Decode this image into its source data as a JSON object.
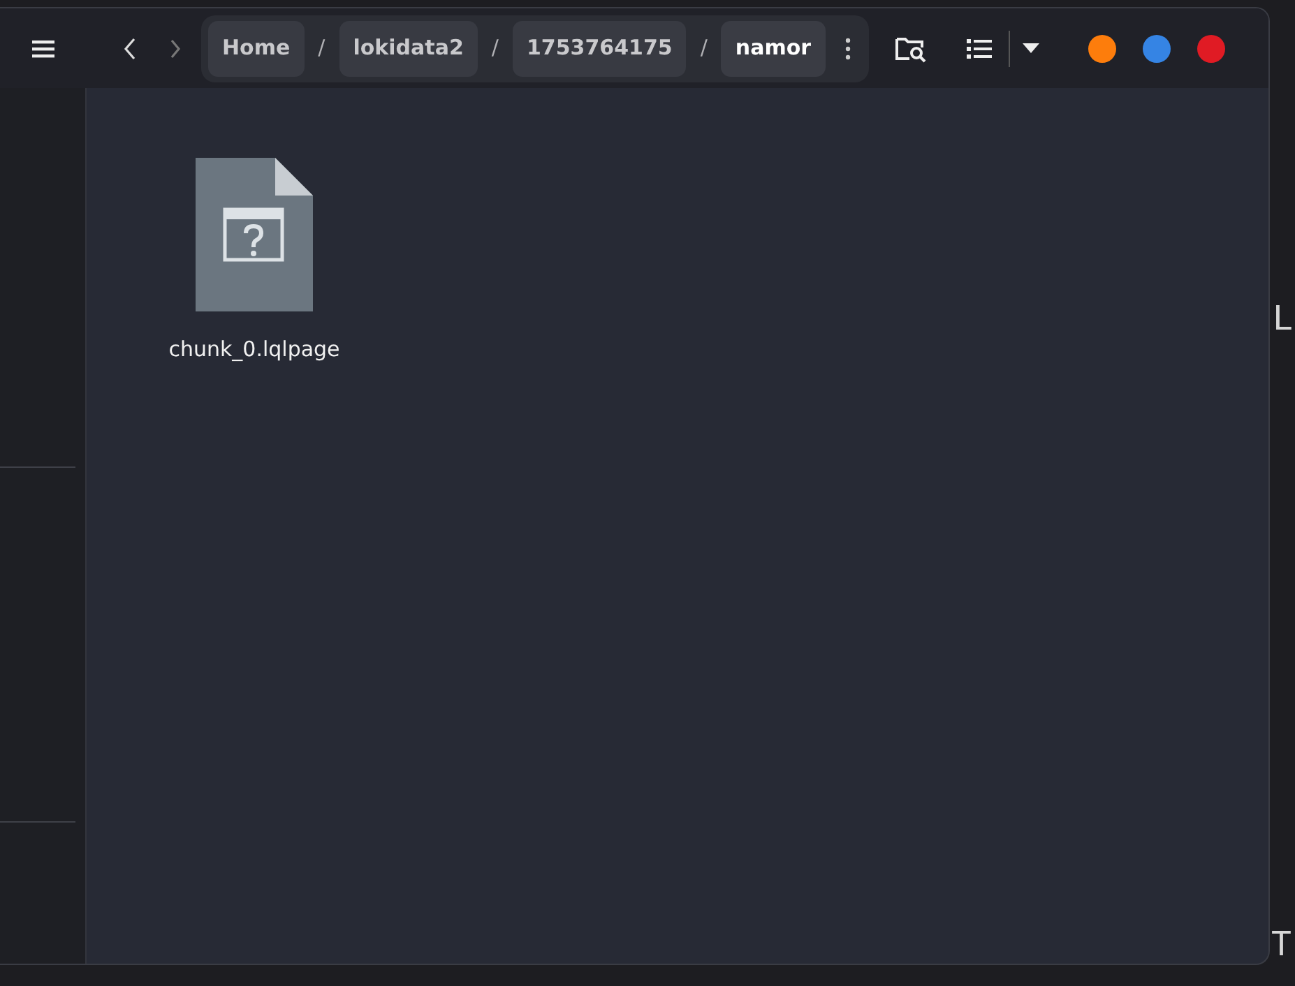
{
  "terminal": {
    "lines": [
      {
        "text": "L"
      },
      {
        "text": "T"
      }
    ]
  },
  "file_manager": {
    "path": [
      {
        "label": "Home",
        "selected": false
      },
      {
        "label": "lokidata2",
        "selected": false
      },
      {
        "label": "1753764175",
        "selected": false
      },
      {
        "label": "namor",
        "selected": true
      }
    ],
    "separator": "/",
    "files": [
      {
        "name": "chunk_0.lqlpage"
      }
    ]
  }
}
